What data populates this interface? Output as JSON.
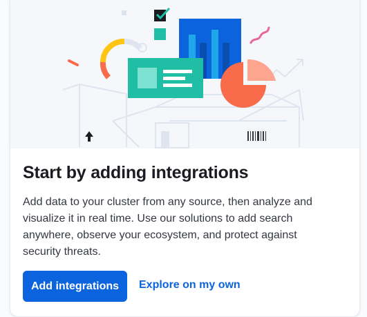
{
  "card": {
    "title": "Start by adding integrations",
    "description": "Add data to your cluster from any source, then analyze and visualize it in real time. Use our solutions to add search anywhere, observe your ecosystem, and protect against security threats.",
    "primary_button_label": "Add integrations",
    "secondary_link_label": "Explore on my own"
  },
  "colors": {
    "primary": "#0b64dd",
    "illustration_blue": "#0b64dd",
    "illustration_teal": "#20bfa5",
    "illustration_orange": "#f86b4b",
    "illustration_yellow": "#fec514",
    "illustration_pink": "#e7669d"
  },
  "illustration": {
    "icons": [
      "checklist-icon",
      "bar-chart-icon",
      "pie-chart-icon",
      "donut-chart-icon",
      "document-card-icon",
      "box-icon",
      "upload-arrow-icon",
      "barcode-icon",
      "trend-arrow-icon"
    ]
  }
}
